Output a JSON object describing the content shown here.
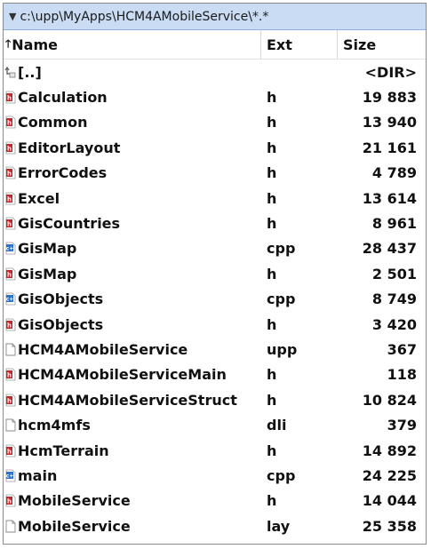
{
  "path": "c:\\upp\\MyApps\\HCM4AMobileService\\*.*",
  "header": {
    "name": "Name",
    "ext": "Ext",
    "size": "Size"
  },
  "rows": [
    {
      "name": "[..]",
      "ext": "",
      "size": "<DIR>",
      "icon": "parent-folder-icon"
    },
    {
      "name": "Calculation",
      "ext": "h",
      "size": "19 883",
      "icon": "header-file-icon"
    },
    {
      "name": "Common",
      "ext": "h",
      "size": "13 940",
      "icon": "header-file-icon"
    },
    {
      "name": "EditorLayout",
      "ext": "h",
      "size": "21 161",
      "icon": "header-file-icon"
    },
    {
      "name": "ErrorCodes",
      "ext": "h",
      "size": "4 789",
      "icon": "header-file-icon"
    },
    {
      "name": "Excel",
      "ext": "h",
      "size": "13 614",
      "icon": "header-file-icon"
    },
    {
      "name": "GisCountries",
      "ext": "h",
      "size": "8 961",
      "icon": "header-file-icon"
    },
    {
      "name": "GisMap",
      "ext": "cpp",
      "size": "28 437",
      "icon": "cpp-file-icon"
    },
    {
      "name": "GisMap",
      "ext": "h",
      "size": "2 501",
      "icon": "header-file-icon"
    },
    {
      "name": "GisObjects",
      "ext": "cpp",
      "size": "8 749",
      "icon": "cpp-file-icon"
    },
    {
      "name": "GisObjects",
      "ext": "h",
      "size": "3 420",
      "icon": "header-file-icon"
    },
    {
      "name": "HCM4AMobileService",
      "ext": "upp",
      "size": "367",
      "icon": "blank-file-icon"
    },
    {
      "name": "HCM4AMobileServiceMain",
      "ext": "h",
      "size": "118",
      "icon": "header-file-icon"
    },
    {
      "name": "HCM4AMobileServiceStruct",
      "ext": "h",
      "size": "10 824",
      "icon": "header-file-icon"
    },
    {
      "name": "hcm4mfs",
      "ext": "dli",
      "size": "379",
      "icon": "blank-file-icon"
    },
    {
      "name": "HcmTerrain",
      "ext": "h",
      "size": "14 892",
      "icon": "header-file-icon"
    },
    {
      "name": "main",
      "ext": "cpp",
      "size": "24 225",
      "icon": "cpp-file-icon"
    },
    {
      "name": "MobileService",
      "ext": "h",
      "size": "14 044",
      "icon": "header-file-icon"
    },
    {
      "name": "MobileService",
      "ext": "lay",
      "size": "25 358",
      "icon": "blank-file-icon"
    }
  ]
}
